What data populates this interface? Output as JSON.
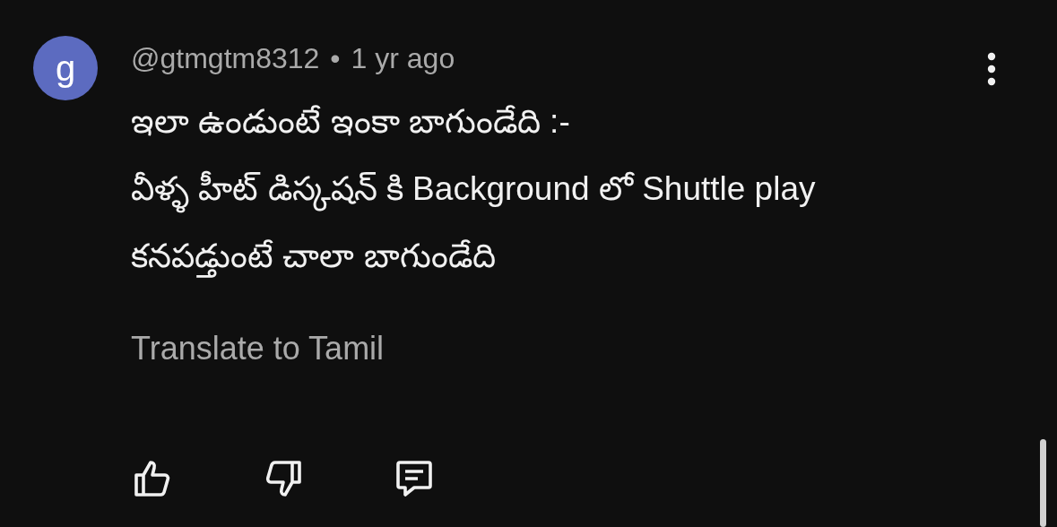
{
  "comment": {
    "avatar": {
      "letter": "g",
      "color": "#5c6bc0"
    },
    "author": "@gtmgtm8312",
    "separator": "•",
    "time": "1 yr ago",
    "lines": [
      "ఇలా ఉండుంటే ఇంకా బాగుండేది :-",
      "వీళ్ళ హీట్ డిస్కషన్ కి Background లో Shuttle play",
      "కనపడ్తుంటే చాలా బాగుండేది"
    ],
    "translate": "Translate to Tamil"
  }
}
